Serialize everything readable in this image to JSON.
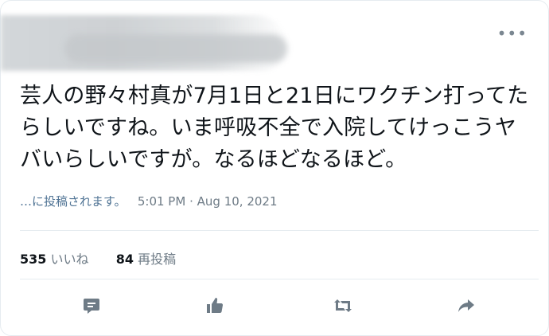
{
  "tweet": {
    "text_line1": "芸人の野々村真が7月1日と21日にワクチン打ってた",
    "text_line2": "らしいですね。いま呼吸不全で入院してけっこうヤ",
    "text_line3": "バいらしいですが。なるほどなるほど。",
    "via": "…に投稿されます。",
    "time": "5:01 PM",
    "separator": "·",
    "date": "Aug 10, 2021",
    "more_glyph": "•••"
  },
  "stats": {
    "likes_count": "535",
    "likes_label": "いいね",
    "retweets_count": "84",
    "retweets_label": "再投稿"
  },
  "icons": {
    "reply": "comment-icon",
    "like": "thumbs-up-icon",
    "retweet": "retweet-icon",
    "share": "share-arrow-icon"
  }
}
